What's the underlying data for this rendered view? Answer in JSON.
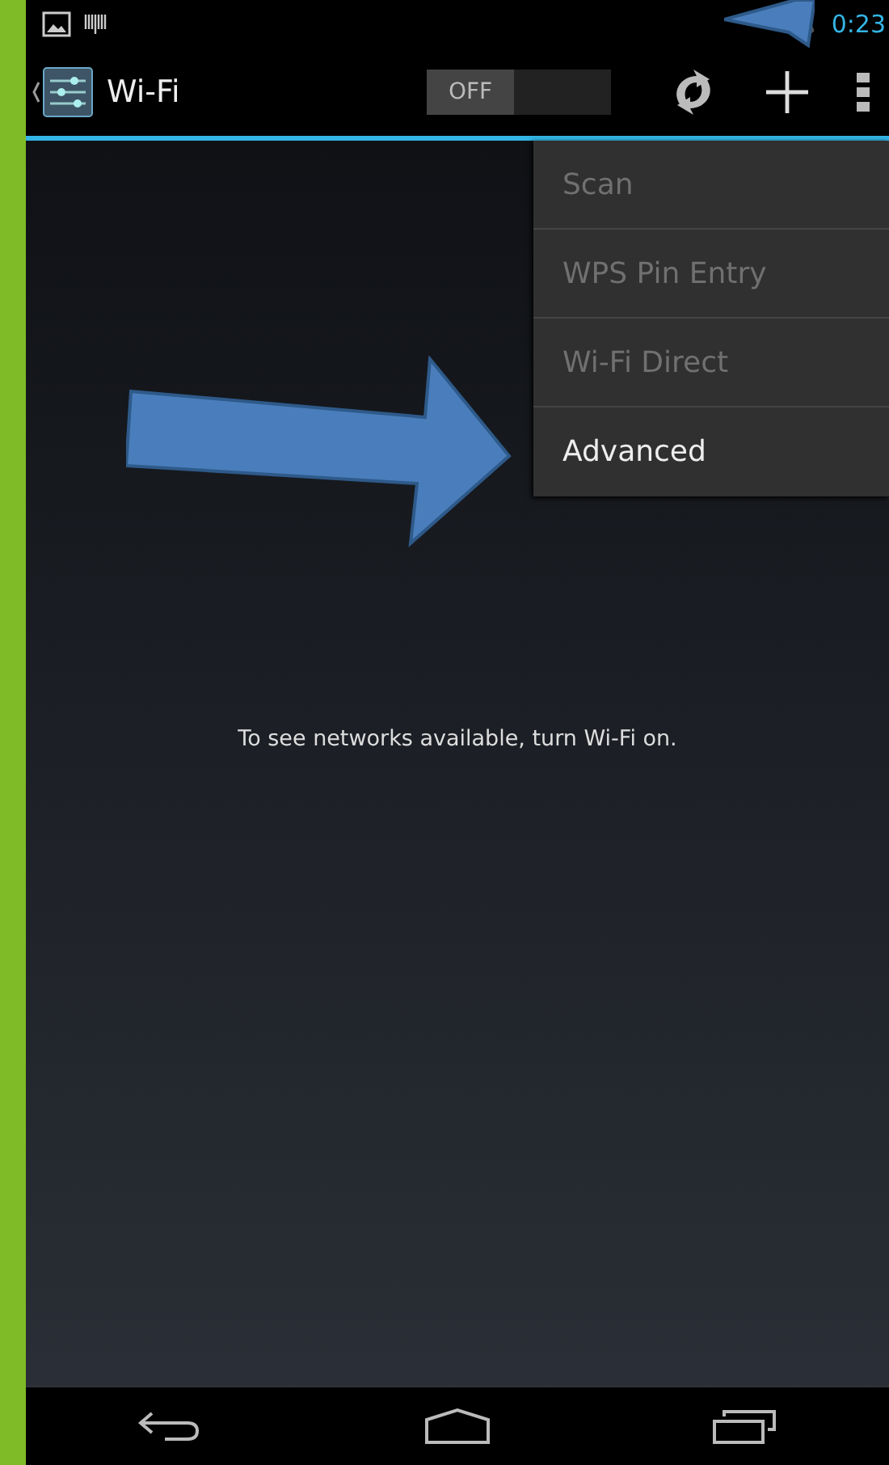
{
  "status_bar": {
    "clock": "0:23"
  },
  "action_bar": {
    "title": "Wi-Fi",
    "switch": {
      "label": "OFF",
      "on": false
    }
  },
  "menu": [
    {
      "label": "Scan",
      "disabled": true
    },
    {
      "label": "WPS Pin Entry",
      "disabled": true
    },
    {
      "label": "Wi-Fi Direct",
      "disabled": true
    },
    {
      "label": "Advanced",
      "disabled": false
    }
  ],
  "message": "To see networks available, turn Wi-Fi on."
}
